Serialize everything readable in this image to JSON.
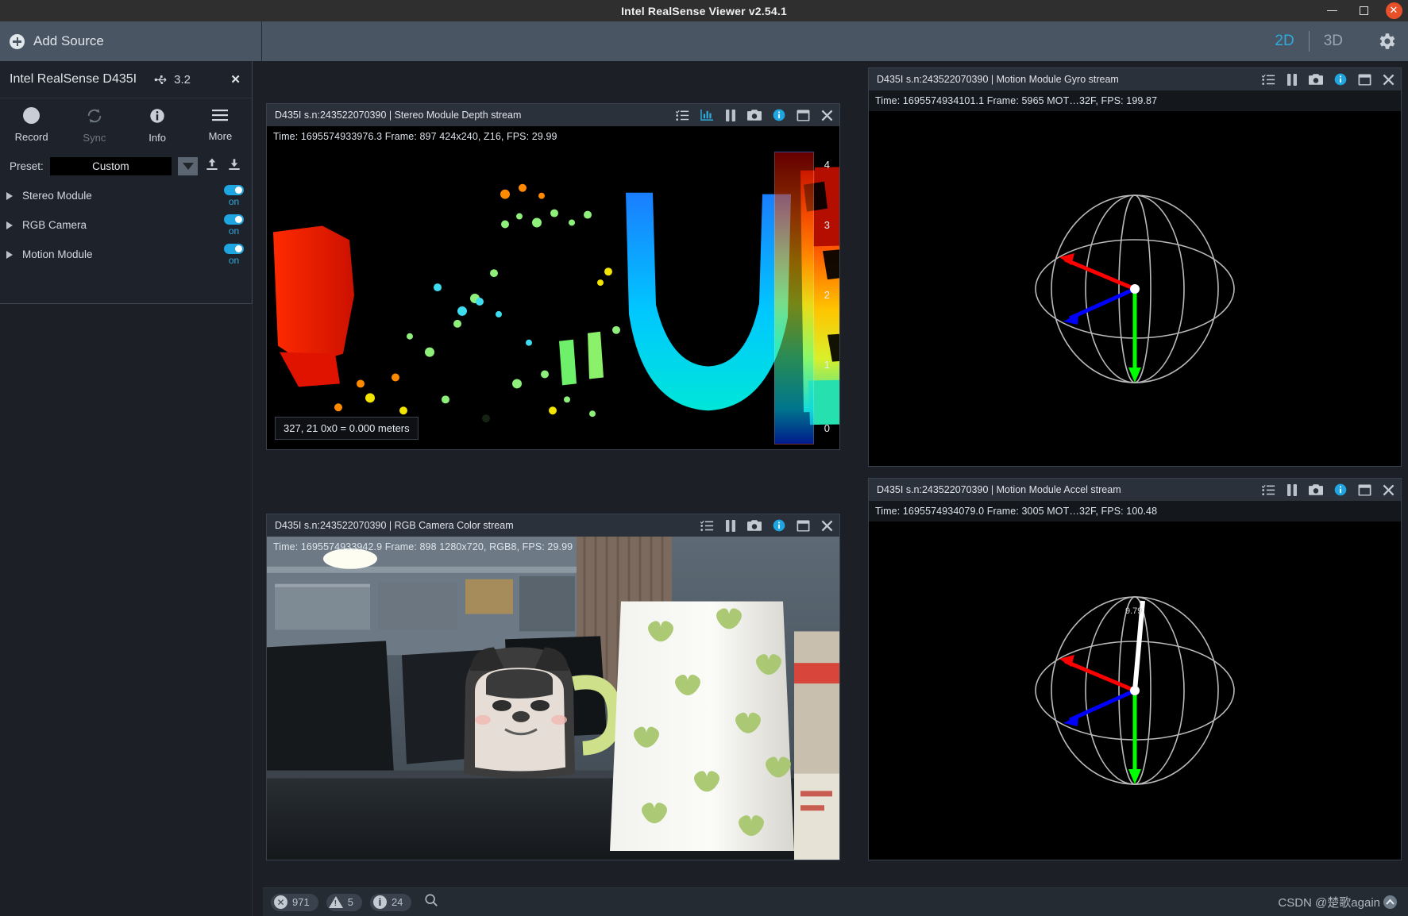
{
  "window": {
    "title": "Intel RealSense Viewer v2.54.1",
    "minimize": "–",
    "maximize": "□",
    "close": "✕"
  },
  "toolbar": {
    "add_source": "Add Source",
    "view_2d": "2D",
    "view_3d": "3D",
    "settings_icon": "gear-icon"
  },
  "device": {
    "name": "Intel RealSense D435I",
    "usb_version": "3.2",
    "close": "✕",
    "actions": [
      {
        "label": "Record",
        "icon": "record-dot-icon",
        "enabled": true
      },
      {
        "label": "Sync",
        "icon": "sync-icon",
        "enabled": false
      },
      {
        "label": "Info",
        "icon": "info-icon",
        "enabled": true
      },
      {
        "label": "More",
        "icon": "hamburger-icon",
        "enabled": true
      }
    ],
    "preset": {
      "label": "Preset:",
      "value": "Custom",
      "upload_icon": "upload-icon",
      "download_icon": "download-icon"
    },
    "modules": [
      {
        "label": "Stereo Module",
        "state": "on"
      },
      {
        "label": "RGB Camera",
        "state": "on"
      },
      {
        "label": "Motion Module",
        "state": "on"
      }
    ]
  },
  "streams": {
    "depth": {
      "title": "D435I s.n:243522070390 | Stereo Module Depth stream",
      "info": "Time: 1695574933976.3    Frame: 897  424x240,  Z16,   FPS:   29.99",
      "readout": "327, 21 0x0 = 0.000 meters",
      "colorbar_ticks": [
        "4",
        "3",
        "2",
        "1",
        "0"
      ],
      "icons": [
        "list-icon",
        "chart-icon",
        "pause-icon",
        "camera-icon",
        "info-icon",
        "window-icon",
        "close-icon"
      ]
    },
    "color": {
      "title": "D435I s.n:243522070390 | RGB Camera Color stream",
      "info": "Time: 1695574933942.9    Frame: 898  1280x720,  RGB8,   FPS:   29.99",
      "icons": [
        "list-icon",
        "pause-icon",
        "camera-icon",
        "info-icon",
        "window-icon",
        "close-icon"
      ]
    },
    "gyro": {
      "title": "D435I s.n:243522070390 | Motion Module Gyro stream",
      "info": "Time: 1695574934101.1    Frame: 5965  MOT…32F,  FPS:  199.87",
      "icons": [
        "list-icon",
        "pause-icon",
        "camera-icon",
        "info-icon",
        "window-icon",
        "close-icon"
      ]
    },
    "accel": {
      "title": "D435I s.n:243522070390 | Motion Module Accel stream",
      "info": "Time: 1695574934079.0    Frame: 3005  MOT…32F,  FPS:  100.48",
      "icons": [
        "list-icon",
        "pause-icon",
        "camera-icon",
        "info-icon",
        "window-icon",
        "close-icon"
      ]
    }
  },
  "statusbar": {
    "errors": "971",
    "warnings": "5",
    "infos": "24",
    "search_icon": "search-icon",
    "watermark": "CSDN @楚歌again"
  },
  "colors": {
    "accent": "#2eaadc",
    "toolbar_bg": "#495562",
    "panel_bg": "#1e232b",
    "close_btn": "#e8502a"
  }
}
